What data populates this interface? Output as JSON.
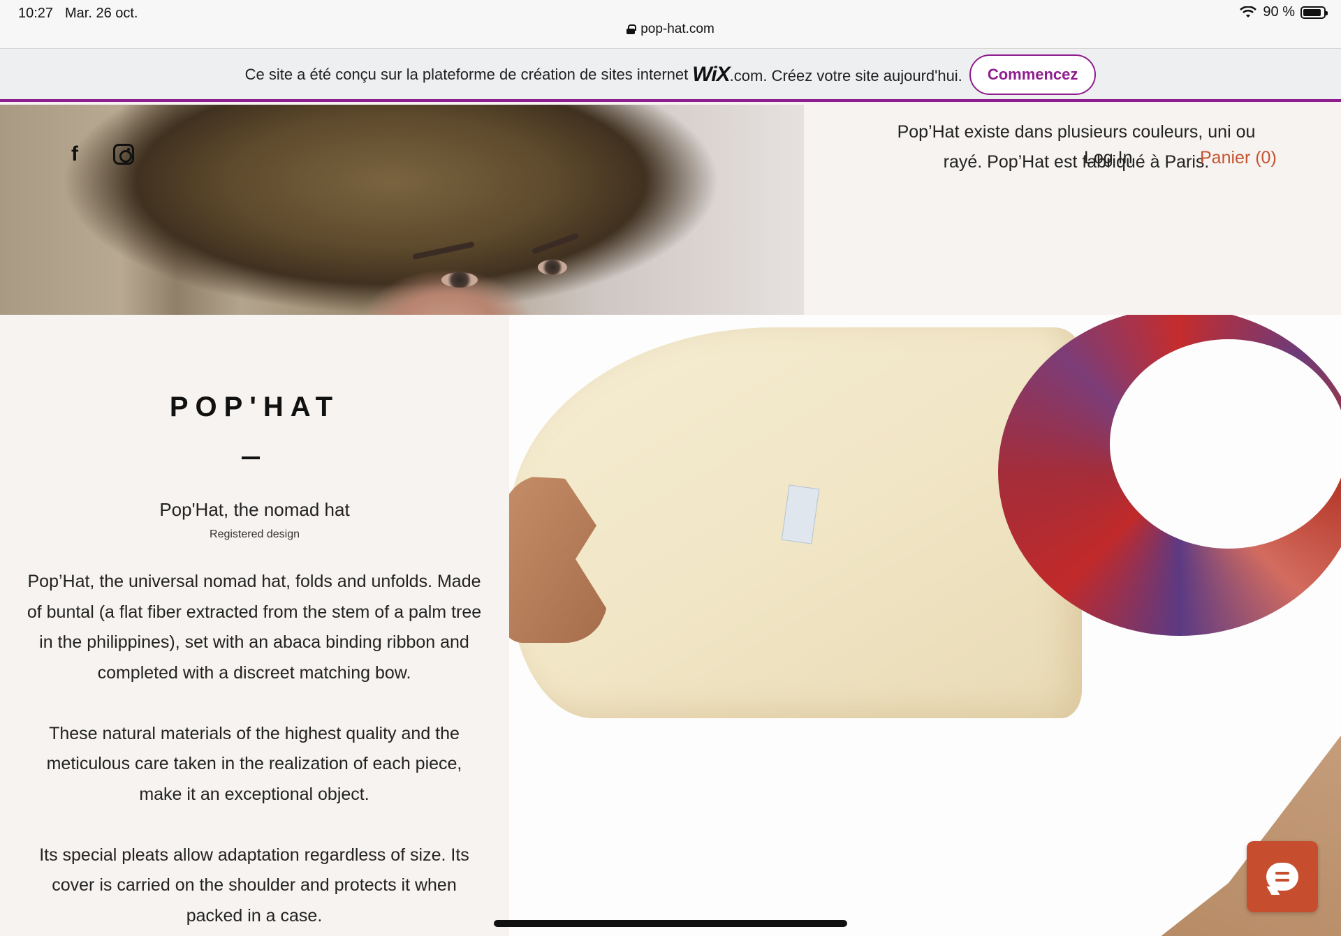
{
  "status_bar": {
    "time": "10:27",
    "date": "Mar. 26 oct.",
    "battery": "90 %",
    "battery_level": 0.9
  },
  "browser": {
    "url": "pop-hat.com"
  },
  "wix_banner": {
    "text_before": "Ce site a été conçu sur la plateforme de création de sites internet",
    "logo": "WiX",
    "text_after": ".com. Créez votre site aujourd'hui.",
    "cta": "Commencez"
  },
  "social": {
    "facebook_glyph": "f",
    "icons": [
      "facebook-icon",
      "instagram-icon"
    ]
  },
  "top_right": {
    "text": "Pop’Hat existe dans plusieurs couleurs, uni ou rayé. Pop’Hat est fabriqué à Paris.",
    "login": "Log In",
    "cart": "Panier (0)"
  },
  "product": {
    "title": "POP'HAT",
    "subtitle": "Pop'Hat, the nomad hat",
    "registered": "Registered design",
    "paragraphs": [
      "Pop’Hat, the universal nomad hat, folds and unfolds. Made of buntal (a flat fiber extracted from the stem of a palm tree in the philippines), set with an abaca binding ribbon and completed with a discreet matching bow.",
      "These natural materials of the highest quality and the meticulous care taken in the realization of each piece, make it an exceptional object.",
      "Its special pleats allow adaptation regardless of size. Its cover is carried on the shoulder and protects it when packed in a case."
    ]
  },
  "colors": {
    "wix_accent": "#8e1d8e",
    "cart_accent": "#c4532f",
    "chat_button": "#c64d2d",
    "page_bg": "#f6f3f0"
  }
}
